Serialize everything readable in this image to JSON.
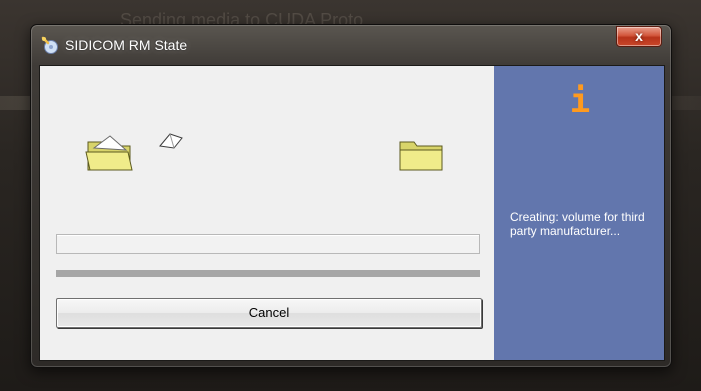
{
  "window": {
    "title": "SIDICOM RM State",
    "close_label": "x"
  },
  "info": {
    "icon_glyph": "i",
    "icon_color": "#ff9a1f",
    "status_text": "Creating: volume for third party manufacturer..."
  },
  "progress": {
    "file_progress": 0,
    "overall_progress": 1
  },
  "buttons": {
    "cancel_label": "Cancel"
  },
  "colors": {
    "side_panel": "#6276ad",
    "folder_fill": "#f0ec8a"
  },
  "icons": {
    "app": "app-cd-icon",
    "source": "folder-open-icon",
    "destination": "folder-icon",
    "paper": "flying-paper-icon"
  }
}
